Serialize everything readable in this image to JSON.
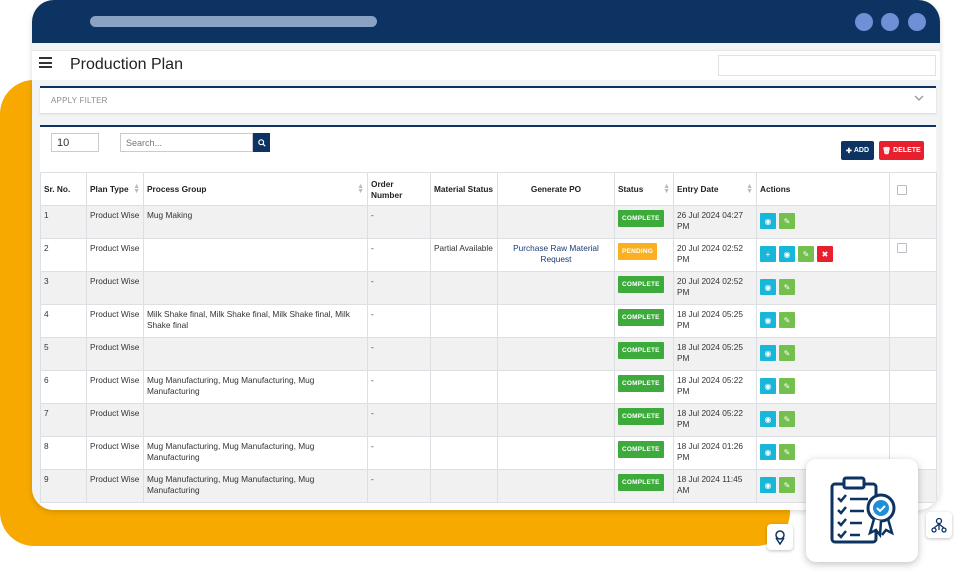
{
  "page": {
    "title": "Production Plan"
  },
  "filter": {
    "label": "APPLY FILTER"
  },
  "table_controls": {
    "page_length": "10",
    "search_placeholder": "Search...",
    "add_label": "ADD",
    "delete_label": "DELETE"
  },
  "columns": [
    "Sr. No.",
    "Plan Type",
    "Process Group",
    "Order Number",
    "Material Status",
    "Generate PO",
    "Status",
    "Entry Date",
    "Actions"
  ],
  "rows": [
    {
      "sr": "1",
      "plan": "Product Wise",
      "group": "Mug Making",
      "order": "-",
      "material": "",
      "po": "",
      "status": "COMPLETE",
      "date": "26 Jul 2024 04:27 PM"
    },
    {
      "sr": "2",
      "plan": "Product Wise",
      "group": "",
      "order": "-",
      "material": "Partial Available",
      "po": "Purchase Raw Material Request",
      "status": "PENDING",
      "date": "20 Jul 2024 02:52 PM"
    },
    {
      "sr": "3",
      "plan": "Product Wise",
      "group": "",
      "order": "-",
      "material": "",
      "po": "",
      "status": "COMPLETE",
      "date": "20 Jul 2024 02:52 PM"
    },
    {
      "sr": "4",
      "plan": "Product Wise",
      "group": "Milk Shake final, Milk Shake final, Milk Shake final, Milk Shake final",
      "order": "-",
      "material": "",
      "po": "",
      "status": "COMPLETE",
      "date": "18 Jul 2024 05:25 PM"
    },
    {
      "sr": "5",
      "plan": "Product Wise",
      "group": "",
      "order": "-",
      "material": "",
      "po": "",
      "status": "COMPLETE",
      "date": "18 Jul 2024 05:25 PM"
    },
    {
      "sr": "6",
      "plan": "Product Wise",
      "group": "Mug Manufacturing, Mug Manufacturing, Mug Manufacturing",
      "order": "-",
      "material": "",
      "po": "",
      "status": "COMPLETE",
      "date": "18 Jul 2024 05:22 PM"
    },
    {
      "sr": "7",
      "plan": "Product Wise",
      "group": "",
      "order": "-",
      "material": "",
      "po": "",
      "status": "COMPLETE",
      "date": "18 Jul 2024 05:22 PM"
    },
    {
      "sr": "8",
      "plan": "Product Wise",
      "group": "Mug Manufacturing, Mug Manufacturing, Mug Manufacturing",
      "order": "-",
      "material": "",
      "po": "",
      "status": "COMPLETE",
      "date": "18 Jul 2024 01:26 PM"
    },
    {
      "sr": "9",
      "plan": "Product Wise",
      "group": "Mug Manufacturing, Mug Manufacturing, Mug Manufacturing",
      "order": "-",
      "material": "",
      "po": "",
      "status": "COMPLETE",
      "date": "18 Jul 2024 11:45 AM"
    }
  ],
  "colors": {
    "navy": "#0c3361",
    "accent_yellow": "#f7a900",
    "complete": "#3cab3c",
    "pending": "#fbb021",
    "view": "#18b6d8",
    "edit": "#74c04e",
    "delete": "#e8202e"
  },
  "icons": [
    "menu-icon",
    "search-icon",
    "chevron-down-icon",
    "eye-icon",
    "pencil-icon",
    "plus-icon",
    "trash-icon",
    "checklist-badge-icon",
    "location-icon",
    "network-icon"
  ]
}
